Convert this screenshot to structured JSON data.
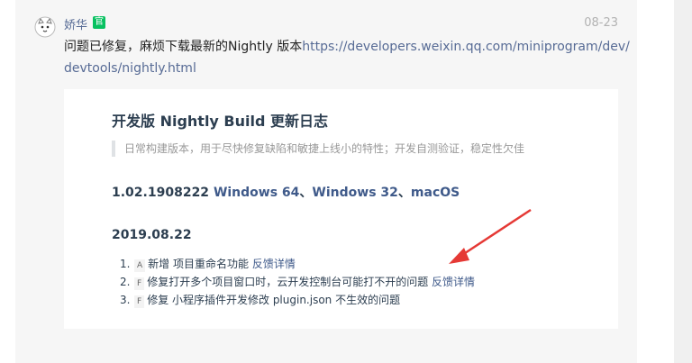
{
  "user": {
    "name": "娇华",
    "badge": "官",
    "date": "08-23"
  },
  "message": {
    "text": "问题已修复，麻烦下载最新的Nightly 版本",
    "link": "https://developers.weixin.qq.com/miniprogram/dev/devtools/nightly.html"
  },
  "doc": {
    "title": "开发版 Nightly Build 更新日志",
    "quote": "日常构建版本，用于尽快修复缺陷和敏捷上线小的特性；开发自测验证，稳定性欠佳",
    "version": {
      "number": "1.02.1908222",
      "win64": "Windows 64",
      "sep1": "、",
      "win32": "Windows 32",
      "sep2": "、",
      "mac": "macOS"
    },
    "date": "2019.08.22",
    "changes": [
      {
        "num": "1.",
        "tag": "A",
        "text": "新增 项目重命名功能",
        "link": "反馈详情"
      },
      {
        "num": "2.",
        "tag": "F",
        "text": "修复打开多个项目窗口时，云开发控制台可能打不开的问题",
        "link": "反馈详情"
      },
      {
        "num": "3.",
        "tag": "F",
        "text": "修复 小程序插件开发修改 plugin.json 不生效的问题",
        "link": ""
      }
    ]
  },
  "colors": {
    "link": "#576b95",
    "badge": "#07c160",
    "arrow": "#e53935"
  },
  "icons": {
    "avatar": "cat-avatar-icon",
    "arrow": "red-arrow-annotation"
  }
}
